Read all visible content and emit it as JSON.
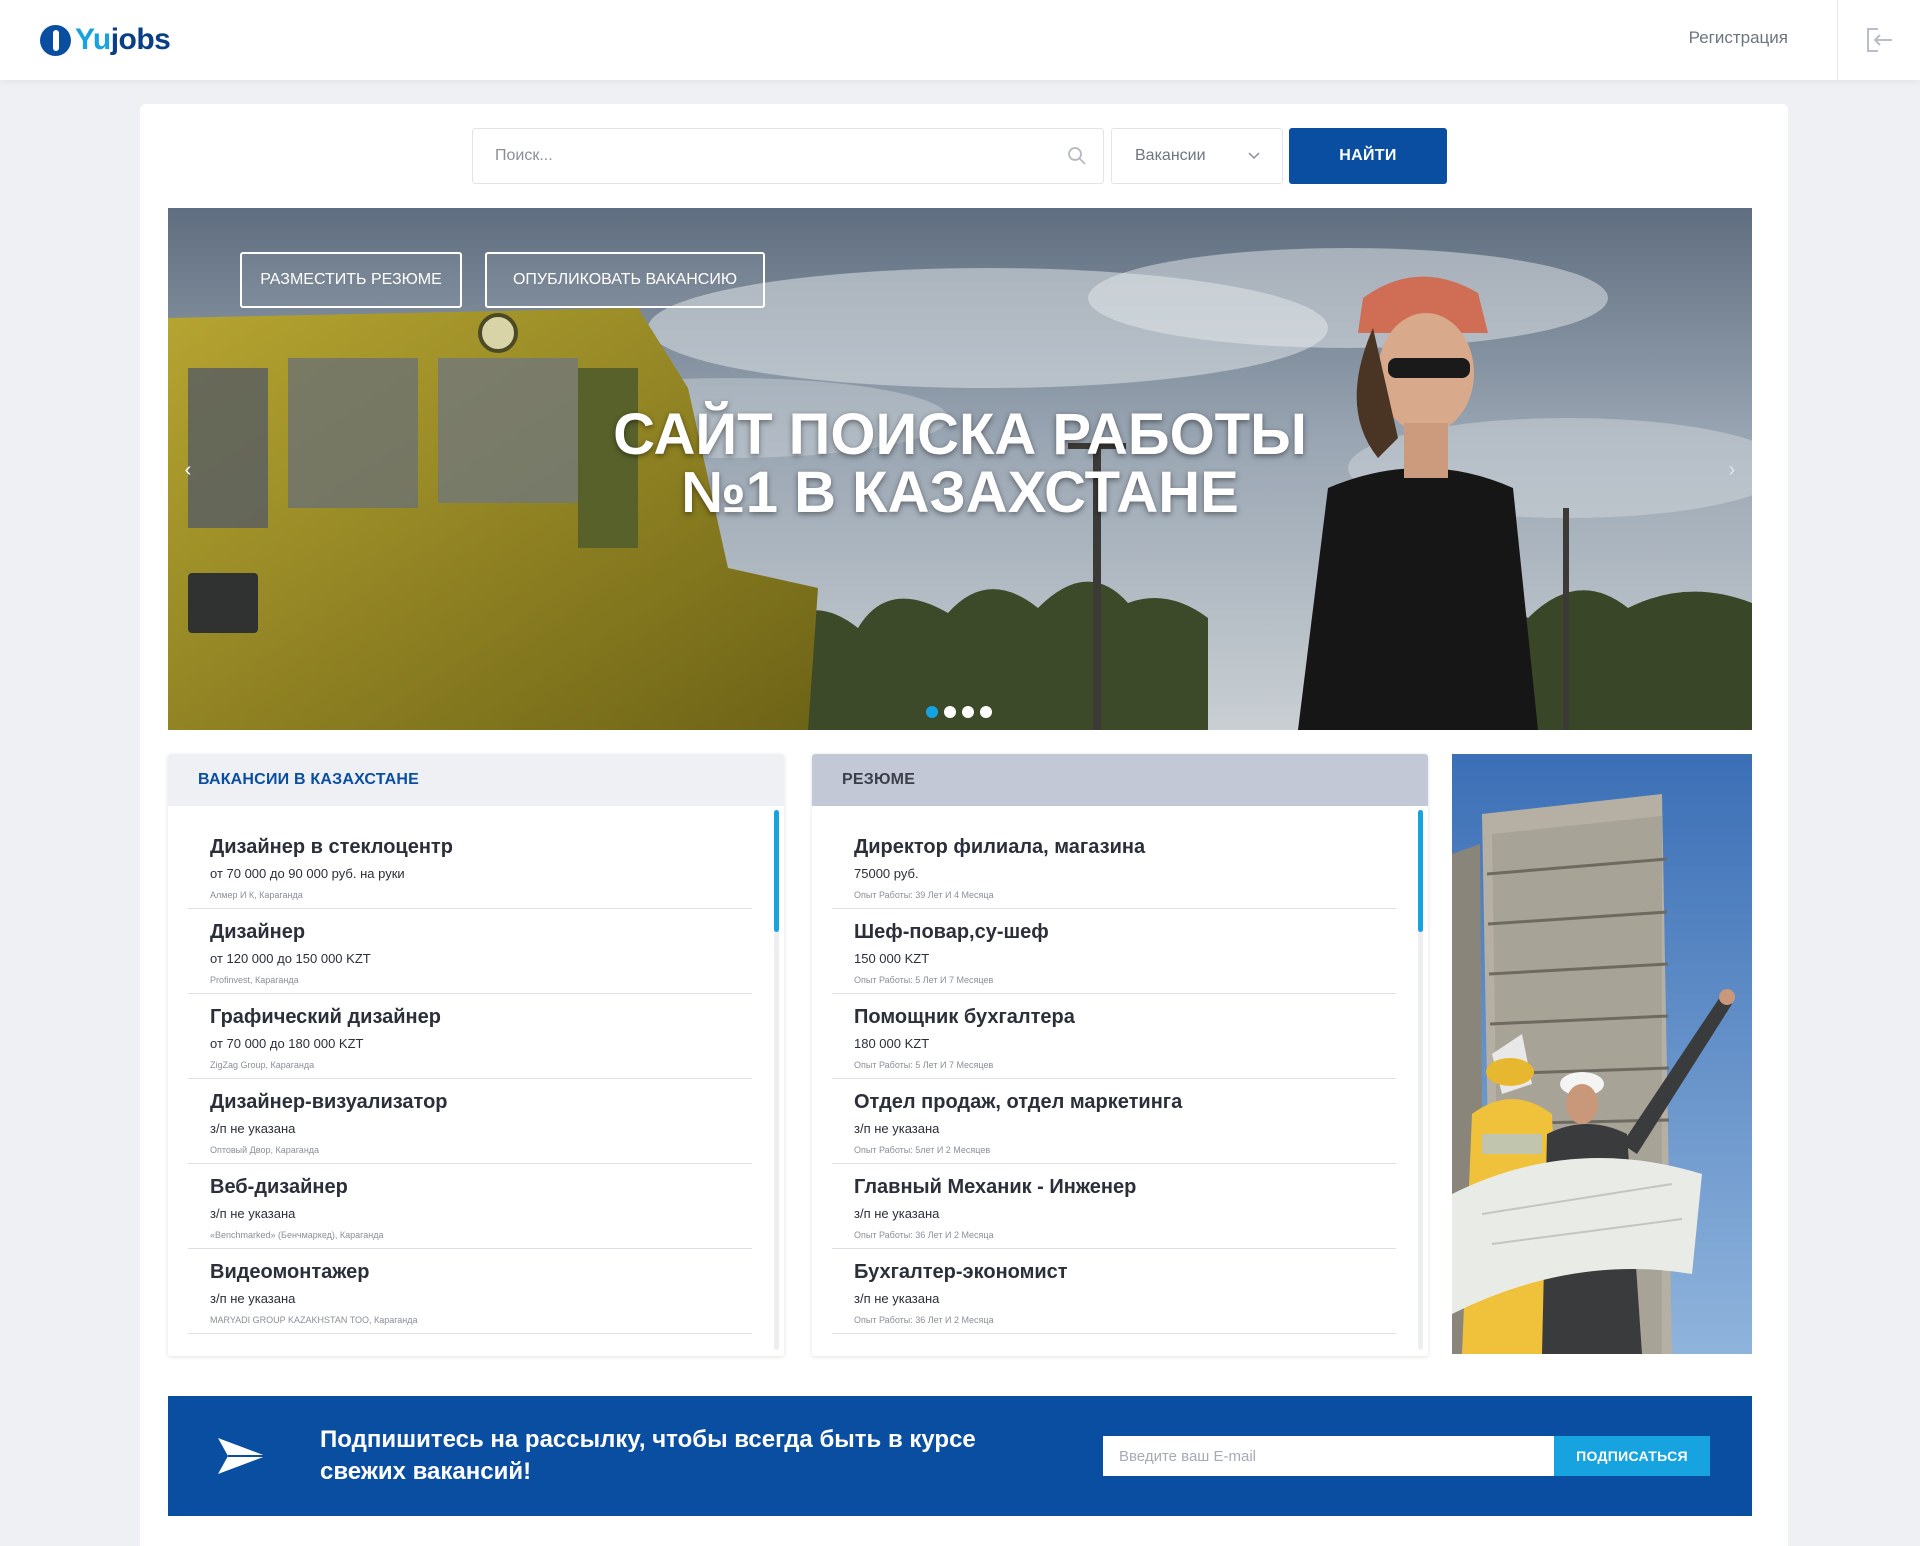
{
  "header": {
    "logo_yu": "Yu",
    "logo_jobs": "jobs",
    "register_label": "Регистрация",
    "login_icon": "logout-arrow-icon"
  },
  "search": {
    "placeholder": "Поиск...",
    "value": "",
    "search_icon": "magnifier-icon",
    "category_selected": "Вакансии",
    "submit_label": "НАЙТИ"
  },
  "hero": {
    "post_resume_label": "РАЗМЕСТИТЬ РЕЗЮМЕ",
    "post_vacancy_label": "ОПУБЛИКОВАТЬ ВАКАНСИЮ",
    "title_line1": "САЙТ ПОИСКА РАБОТЫ",
    "title_line2": "№1 В КАЗАХСТАНЕ",
    "prev_arrow": "‹",
    "next_arrow": "›",
    "slide_count": 4,
    "active_slide": 1
  },
  "vacancies": {
    "header": "ВАКАНСИИ В КАЗАХСТАНЕ",
    "items": [
      {
        "title": "Дизайнер в стеклоцентр",
        "salary": "от 70 000 до 90 000 руб. на руки",
        "meta": "Алмер И К, Караганда"
      },
      {
        "title": "Дизайнер",
        "salary": "от 120 000 до 150 000 KZT",
        "meta": "Profinvest, Караганда"
      },
      {
        "title": "Графический дизайнер",
        "salary": "от 70 000 до 180 000 KZT",
        "meta": "ZigZag Group, Караганда"
      },
      {
        "title": "Дизайнер-визуализатор",
        "salary": "з/п не указана",
        "meta": "Оптовый Двор, Караганда"
      },
      {
        "title": "Веб-дизайнер",
        "salary": "з/п не указана",
        "meta": "«Benchmarked» (Бенчмаркед), Караганда"
      },
      {
        "title": "Видеомонтажер",
        "salary": "з/п не указана",
        "meta": "MARYADI GROUP KAZAKHSTAN ТОО, Караганда"
      }
    ]
  },
  "resumes": {
    "header": "РЕЗЮМЕ",
    "items": [
      {
        "title": "Директор филиала, магазина",
        "salary": "75000 руб.",
        "meta": "Опыт Работы: 39 Лет И 4 Месяца"
      },
      {
        "title": "Шеф-повар,су-шеф",
        "salary": "150 000 KZT",
        "meta": "Опыт Работы: 5 Лет И 7 Месяцев"
      },
      {
        "title": "Помощник бухгалтера",
        "salary": "180 000 KZT",
        "meta": "Опыт Работы: 5 Лет И 7 Месяцев"
      },
      {
        "title": "Отдел продаж, отдел маркетинга",
        "salary": "з/п не указана",
        "meta": "Опыт Работы: 5лет И 2 Месяцев"
      },
      {
        "title": "Главный Механик - Инженер",
        "salary": "з/п не указана",
        "meta": "Опыт Работы: 36 Лет И 2 Месяца"
      },
      {
        "title": "Бухгалтер-экономист",
        "salary": "з/п не указана",
        "meta": "Опыт Работы: 36 Лет И 2 Месяца"
      }
    ]
  },
  "subscribe": {
    "text_line1": "Подпишитесь на рассылку, чтобы всегда быть в курсе",
    "text_line2": "свежих вакансий!",
    "email_placeholder": "Введите ваш E-mail",
    "email_value": "",
    "button_label": "ПОДПИСАТЬСЯ",
    "icon": "paper-plane-icon"
  },
  "colors": {
    "brand_blue": "#0a4ea2",
    "accent_cyan": "#16a3e0",
    "page_bg": "#eef0f3",
    "resume_header_bg": "#c2c8d6"
  }
}
